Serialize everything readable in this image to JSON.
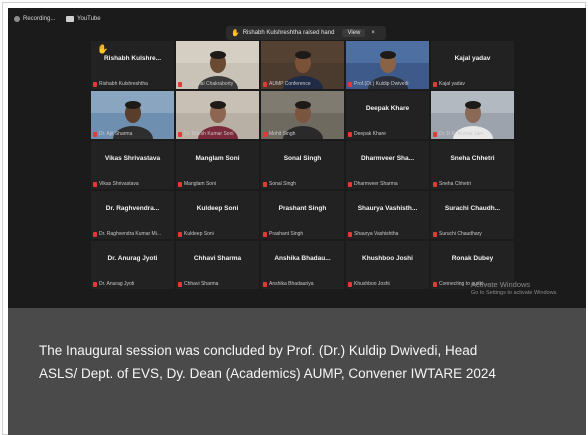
{
  "topbar": {
    "recording_label": "Recording...",
    "youtube_label": "YouTube"
  },
  "notification": {
    "text": "Rishabh Kulshreshtha raised hand",
    "view_label": "View",
    "close_glyph": "×"
  },
  "participants": [
    {
      "name": "Rishabh Kulshre...",
      "caption": "Rishabh Kulshreshtha",
      "video": false,
      "hand": true
    },
    {
      "name": "",
      "caption": "Dr. Kunal Chakraborty",
      "video": true
    },
    {
      "name": "",
      "caption": "AUMP Conference",
      "video": true
    },
    {
      "name": "",
      "caption": "Prof.(Dr.) Kuldip Dwivedi",
      "video": true
    },
    {
      "name": "Kajal yadav",
      "caption": "Kajal yadav",
      "video": false
    },
    {
      "name": "",
      "caption": "Dr. Ajit Sharma",
      "video": true
    },
    {
      "name": "",
      "caption": "Dr. Nitesh Kumar Soni",
      "video": true
    },
    {
      "name": "",
      "caption": "Mohit Singh",
      "video": true,
      "speaking": true
    },
    {
      "name": "Deepak Khare",
      "caption": "Deepak Khare",
      "video": false
    },
    {
      "name": "",
      "caption": "Dr. R.K. Kumar Jain",
      "video": true
    },
    {
      "name": "Vikas Shrivastava",
      "caption": "Vikas Shrivastava",
      "video": false
    },
    {
      "name": "Manglam Soni",
      "caption": "Manglam Soni",
      "video": false
    },
    {
      "name": "Sonal Singh",
      "caption": "Sonal Singh",
      "video": false
    },
    {
      "name": "Dharmveer Sha...",
      "caption": "Dharmveer Sharma",
      "video": false
    },
    {
      "name": "Sneha Chhetri",
      "caption": "Sneha Chhetri",
      "video": false
    },
    {
      "name": "Dr. Raghvendra...",
      "caption": "Dr. Raghvendra Kumar Mi...",
      "video": false
    },
    {
      "name": "Kuldeep Soni",
      "caption": "Kuldeep Soni",
      "video": false
    },
    {
      "name": "Prashant Singh",
      "caption": "Prashant Singh",
      "video": false
    },
    {
      "name": "Shaurya Vashisth...",
      "caption": "Shaurya Vashishtha",
      "video": false
    },
    {
      "name": "Surachi Chaudh...",
      "caption": "Suruchi Chaudhary",
      "video": false
    },
    {
      "name": "Dr. Anurag Jyoti",
      "caption": "Dr. Anurag Jyoti",
      "video": false
    },
    {
      "name": "Chhavi Sharma",
      "caption": "Chhavi Sharma",
      "video": false
    },
    {
      "name": "Anshika Bhadau...",
      "caption": "Anshika Bhadauriya",
      "video": false
    },
    {
      "name": "Khushboo Joshi",
      "caption": "Khushboo Joshi",
      "video": false
    },
    {
      "name": "Ronak Dubey",
      "caption": "Connecting to audio ...",
      "video": false
    }
  ],
  "watermark": {
    "title": "Activate Windows",
    "subtitle": "Go to Settings to activate Windows."
  },
  "caption": {
    "line1": "The Inaugural session was concluded by Prof. (Dr.) Kuldip Dwivedi, Head",
    "line2": "ASLS/ Dept. of EVS, Dy. Dean (Academics) AUMP, Convener IWTARE 2024"
  },
  "colors": {
    "background": "#1b1b1b",
    "tile": "#222222",
    "speaking_border": "#9ecf2a",
    "hand": "#f4c21a",
    "muted_mic": "#e53935",
    "caption_band": "#4a4a4a"
  }
}
